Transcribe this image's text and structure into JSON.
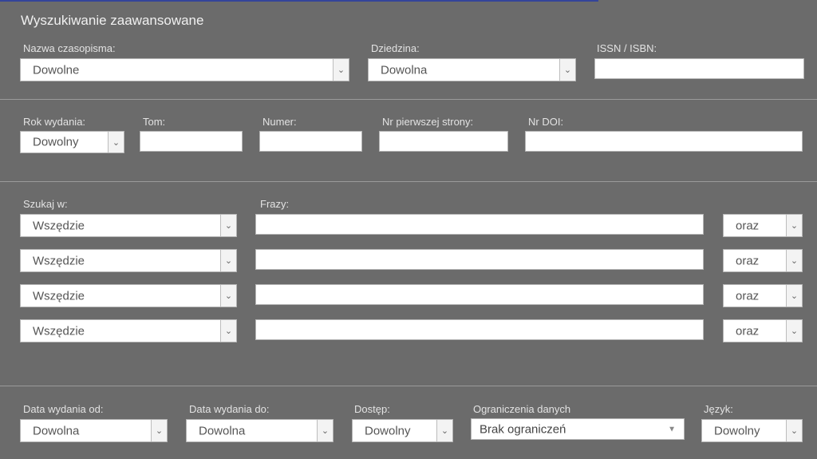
{
  "title": "Wyszukiwanie zaawansowane",
  "row1": {
    "journal_label": "Nazwa czasopisma:",
    "journal_value": "Dowolne",
    "field_label": "Dziedzina:",
    "field_value": "Dowolna",
    "issn_label": "ISSN / ISBN:",
    "issn_value": ""
  },
  "row2": {
    "year_label": "Rok wydania:",
    "year_value": "Dowolny",
    "volume_label": "Tom:",
    "number_label": "Numer:",
    "firstpage_label": "Nr pierwszej strony:",
    "doi_label": "Nr DOI:"
  },
  "search": {
    "in_label": "Szukaj w:",
    "phrases_label": "Frazy:",
    "rows": [
      {
        "scope": "Wszędzie",
        "phrase": "",
        "operator": "oraz"
      },
      {
        "scope": "Wszędzie",
        "phrase": "",
        "operator": "oraz"
      },
      {
        "scope": "Wszędzie",
        "phrase": "",
        "operator": "oraz"
      },
      {
        "scope": "Wszędzie",
        "phrase": "",
        "operator": "oraz"
      }
    ]
  },
  "row4": {
    "date_from_label": "Data wydania od:",
    "date_from_value": "Dowolna",
    "date_to_label": "Data wydania do:",
    "date_to_value": "Dowolna",
    "access_label": "Dostęp:",
    "access_value": "Dowolny",
    "limits_label": "Ograniczenia danych",
    "limits_value": "Brak ograniczeń",
    "lang_label": "Język:",
    "lang_value": "Dowolny"
  },
  "colors": {
    "panel": "#6b6b6b",
    "accent": "#34449a"
  }
}
